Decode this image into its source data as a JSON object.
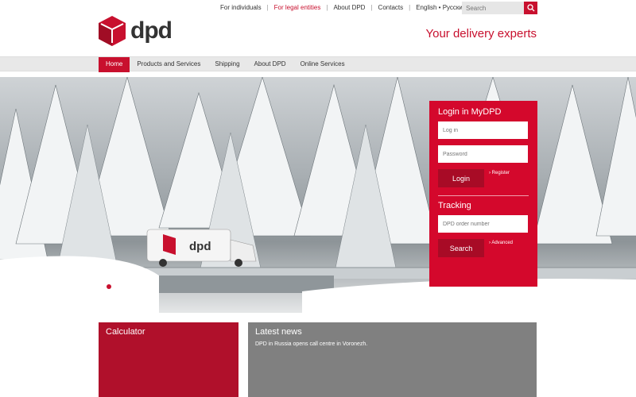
{
  "brand": {
    "logo_text": "dpd",
    "tagline": "Your delivery experts"
  },
  "top_links": [
    {
      "label": "For individuals"
    },
    {
      "label": "For legal entities"
    },
    {
      "label": "About DPD"
    },
    {
      "label": "Contacts"
    },
    {
      "label": "English • Русский"
    }
  ],
  "search": {
    "placeholder": "Search"
  },
  "nav": [
    {
      "label": "Home"
    },
    {
      "label": "Products and Services"
    },
    {
      "label": "Shipping"
    },
    {
      "label": "About DPD"
    },
    {
      "label": "Online Services"
    }
  ],
  "hero": {
    "van_logo_text": "dpd"
  },
  "login": {
    "title": "Login in MyDPD",
    "login_placeholder": "Log in",
    "password_placeholder": "Password",
    "login_button": "Login",
    "register_link": "› Register"
  },
  "tracking": {
    "title": "Tracking",
    "order_placeholder": "DPD order number",
    "search_button": "Search",
    "advanced_link": "› Advanced"
  },
  "calculator": {
    "title": "Calculator"
  },
  "news": {
    "title": "Latest news",
    "item": "DPD in Russia opens call centre in Voronezh."
  },
  "colors": {
    "brand_red": "#c8102e",
    "panel_red": "#d4082c",
    "news_gray": "#808080"
  }
}
